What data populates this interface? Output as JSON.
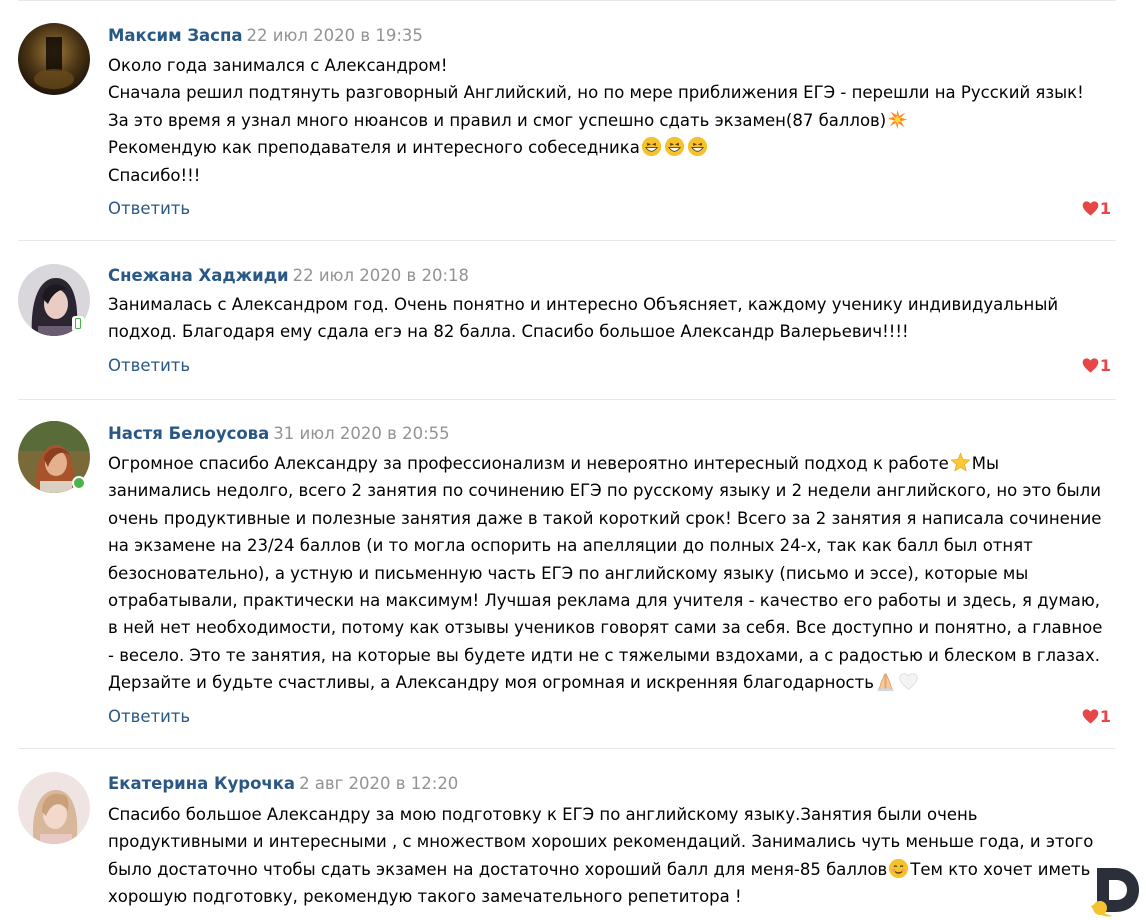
{
  "reply_label": "Ответить",
  "colors": {
    "author": "#2a5885",
    "date": "#939393",
    "like": "#e64646",
    "online": "#4bb34b",
    "divider": "#e7e8ec"
  },
  "comments": [
    {
      "author": "Максим Заспа",
      "date": "22 июл 2020 в 19:35",
      "lines": [
        "Около года занимался с Александром!",
        "Сначала решил подтянуть разговорный Английский, но по мере приближения ЕГЭ - перешли на Русский язык!",
        "За это время я узнал много нюансов и правил и смог успешно сдать экзамен(87 баллов)",
        "Рекомендую как преподавателя и интересного собеседника",
        "Спасибо!!!"
      ],
      "likes": "1"
    },
    {
      "author": "Снежана Хаджиди",
      "date": "22 июл 2020 в 20:18",
      "lines": [
        "Занималась с Александром год. Очень понятно и интересно Объясняет, каждому ученику индивидуальный",
        "подход. Благодаря ему сдала егэ на 82 балла. Спасибо большое Александр Валерьевич!!!!"
      ],
      "likes": "1"
    },
    {
      "author": "Настя Белоусова",
      "date": "31 июл 2020 в 20:55",
      "lines": [
        "Огромное спасибо Александру за профессионализм и невероятно интересный подход к работе",
        "Мы",
        "занимались недолго, всего 2 занятия по сочинению ЕГЭ по русскому языку и 2 недели английского, но это были",
        "очень продуктивные и полезные занятия даже в такой короткий срок! Всего за 2 занятия я написала сочинение",
        "на экзамене на 23/24 баллов (и то могла оспорить на апелляции до полных 24-х, так как балл был отнят",
        "безосновательно), а устную и письменную часть ЕГЭ по английскому языку (письмо и эссе), которые мы",
        "отрабатывали, практически на максимум! Лучшая реклама для учителя - качество его работы и здесь, я думаю,",
        "в ней нет необходимости, потому как отзывы учеников говорят сами за себя. Все доступно и понятно, а главное",
        "- весело. Это те занятия, на которые вы будете идти не с тяжелыми вздохами, а с радостью и блеском в глазах.",
        "Дерзайте и будьте счастливы, а Александру моя огромная и искренняя благодарность"
      ],
      "likes": "1"
    },
    {
      "author": "Екатерина Курочка",
      "date": "2 авг 2020 в 12:20",
      "lines": [
        "Спасибо большое Александру за мою подготовку к ЕГЭ по английскому языку.Занятия были очень",
        "продуктивными и интересными , с множеством хороших рекомендаций. Занимались чуть меньше года, и этого",
        "было достаточно чтобы сдать экзамен на достаточно хороший балл для меня-85 баллов",
        "Тем кто хочет иметь",
        "хорошую подготовку, рекомендую такого замечательного репетитора !"
      ]
    }
  ]
}
